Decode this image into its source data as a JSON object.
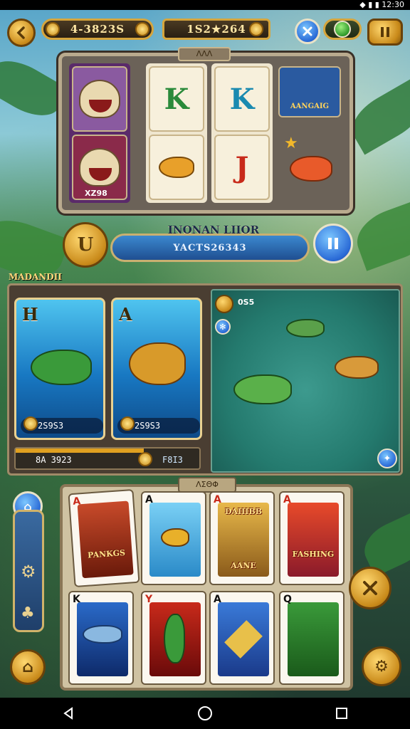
{
  "status": {
    "glyphs": "◆ ▮ ▮ 12:30"
  },
  "hud": {
    "left_counter": "4-3823S",
    "center_counter": "1S2★264",
    "back_icon": "chevron-left-icon",
    "close_icon": "close-icon",
    "toggle_icon": "toggle-icon",
    "pause_icon": "pause-icon"
  },
  "slot": {
    "badge_text": "ΛΛΛ",
    "bonus_label": "AANGAIG",
    "monster_caption": "XZ98",
    "letters": [
      "K",
      "K",
      "J"
    ]
  },
  "spin": {
    "title": "INQNAN LIIOR",
    "value": "YACTS26343",
    "emblem": "U"
  },
  "section": {
    "label": "MADANDII",
    "cards": [
      {
        "letter": "H",
        "value": "2S9S3"
      },
      {
        "letter": "A",
        "value": "2S9S3"
      }
    ],
    "bottom_value": "8A 3923",
    "bottom_right_value": "F8I3",
    "pond_value": "0S5"
  },
  "card_panel": {
    "header_badge": "ΛΣΘΦ",
    "cards": [
      {
        "rank": "A",
        "suit": "♦",
        "caption": "PANKGS"
      },
      {
        "rank": "A",
        "suit": "♠",
        "caption": ""
      },
      {
        "rank": "A",
        "suit": "♦",
        "caption": "DAIIIBB"
      },
      {
        "rank": "A",
        "suit": "♦",
        "caption": "FASHING"
      },
      {
        "rank": "K",
        "suit": "♠",
        "caption": ""
      },
      {
        "rank": "Y",
        "suit": "♦",
        "caption": ""
      },
      {
        "rank": "A",
        "suit": "♠",
        "caption": ""
      },
      {
        "rank": "Q",
        "suit": "♠",
        "caption": ""
      }
    ],
    "card_sub_captions": [
      "AANE"
    ]
  },
  "side_menu": {
    "icons": [
      "home-icon",
      "gear-icon",
      "fleur-icon",
      "house-icon"
    ]
  },
  "right_buttons": {
    "close_icon": "close-icon",
    "settings_icon": "settings-icon"
  },
  "colors": {
    "gold": "#d6a53c",
    "blue": "#2a6ad6",
    "panel": "#4a3e32"
  }
}
